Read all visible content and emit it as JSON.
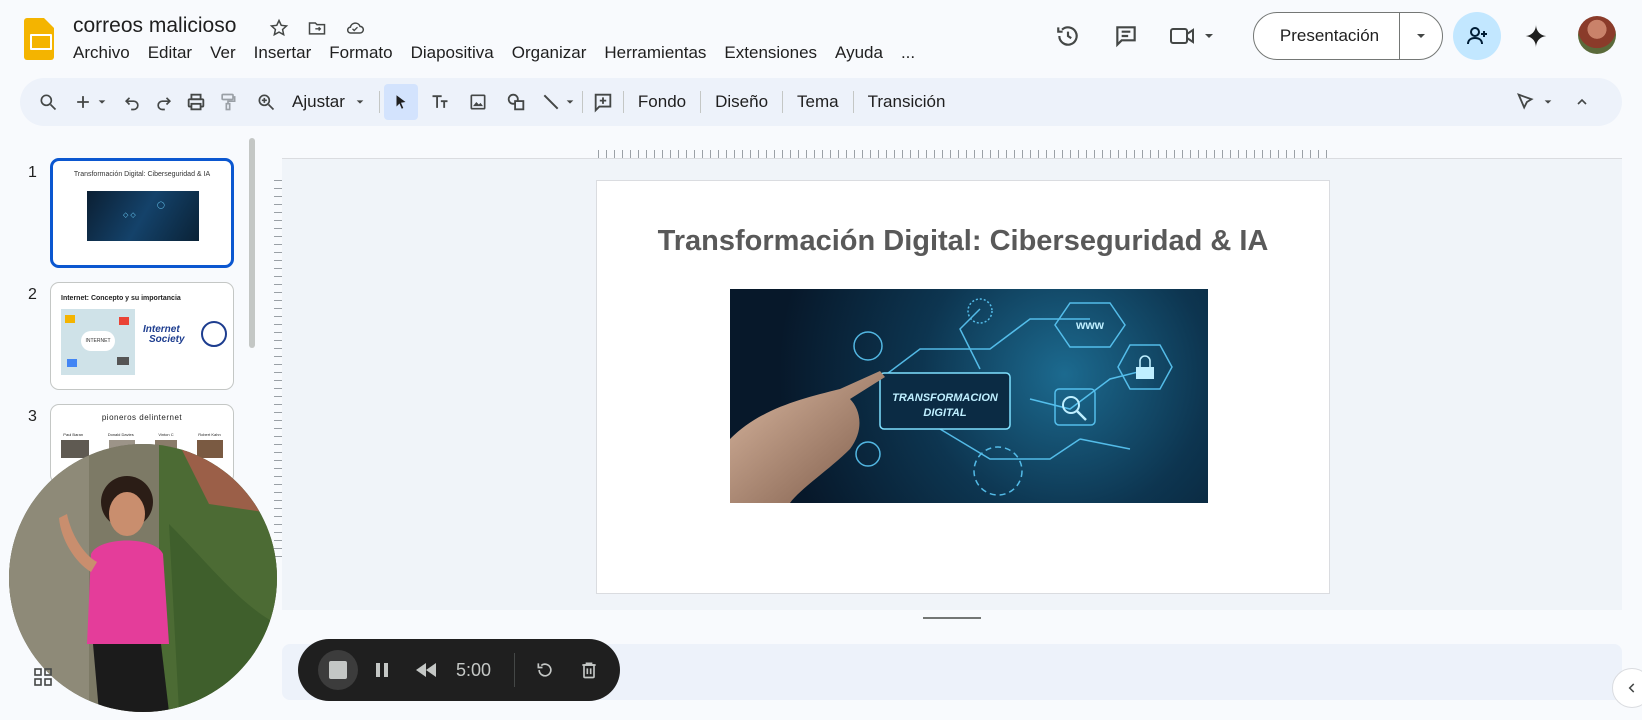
{
  "header": {
    "doc_title": "correos malicioso",
    "menu": [
      "Archivo",
      "Editar",
      "Ver",
      "Insertar",
      "Formato",
      "Diapositiva",
      "Organizar",
      "Herramientas",
      "Extensiones",
      "Ayuda",
      "..."
    ],
    "present_label": "Presentación"
  },
  "toolbar": {
    "zoom_label": "Ajustar",
    "fondo": "Fondo",
    "diseno": "Diseño",
    "tema": "Tema",
    "transicion": "Transición"
  },
  "filmstrip": {
    "slides": [
      {
        "num": "1",
        "title": "Transformación Digital: Ciberseguridad & IA"
      },
      {
        "num": "2",
        "title": "Internet: Concepto y su importancia",
        "logo_text_1": "Internet",
        "logo_text_2": "Society",
        "cloud_label": "INTERNET"
      },
      {
        "num": "3",
        "title": "pioneros delinternet",
        "names": [
          "Paul Baran",
          "Donald Davies",
          "Vinton C",
          "Robert Kahn"
        ]
      }
    ]
  },
  "slide": {
    "title": "Transformación Digital: Ciberseguridad & IA",
    "image_text_1": "TRANSFORMACION",
    "image_text_2": "DIGITAL",
    "image_text_www": "www"
  },
  "recorder": {
    "time": "5:00"
  },
  "colors": {
    "accent": "#0b57d0",
    "share_bg": "#c2e7ff",
    "slides_logo": "#f4b400"
  }
}
